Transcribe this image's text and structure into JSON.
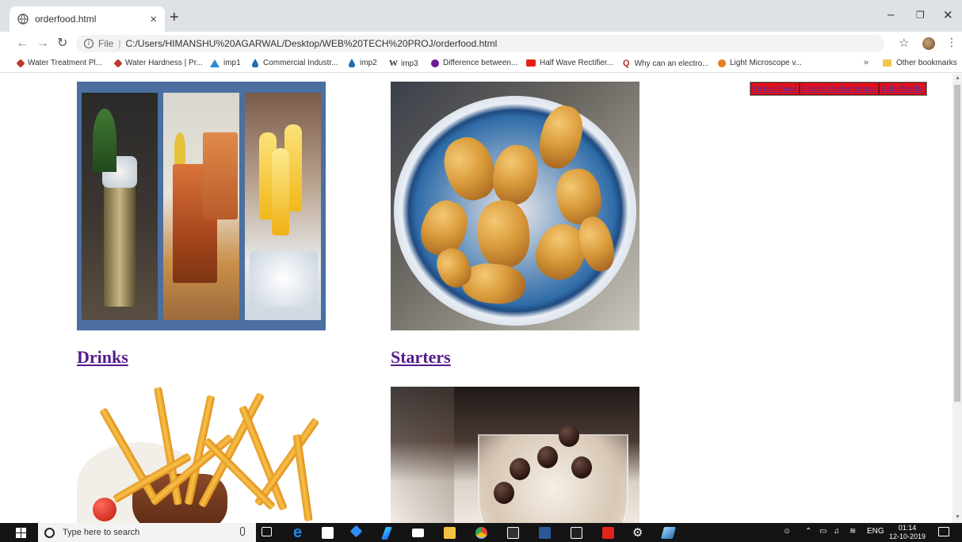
{
  "browser": {
    "tab_title": "orderfood.html",
    "tab_close": "×",
    "new_tab": "+",
    "address": {
      "scheme": "File",
      "separator": "|",
      "url": "C:/Users/HIMANSHU%20AGARWAL/Desktop/WEB%20TECH%20PROJ/orderfood.html"
    },
    "bookmarks": [
      {
        "label": "Water Treatment Pl...",
        "icon": "water-treatment-icon",
        "color": "#c0392b"
      },
      {
        "label": "Water Hardness | Pr...",
        "icon": "water-hardness-icon",
        "color": "#c0392b"
      },
      {
        "label": "imp1",
        "icon": "triangle-icon",
        "color": "#2a8ad4"
      },
      {
        "label": "Commercial Industr...",
        "icon": "droplet-icon",
        "color": "#1d6fb8"
      },
      {
        "label": "imp2",
        "icon": "droplet-icon",
        "color": "#1d6fb8"
      },
      {
        "label": "imp3",
        "icon": "wikipedia-icon",
        "color": "#222222"
      },
      {
        "label": "Difference between...",
        "icon": "circle-e-icon",
        "color": "#6a1b9a"
      },
      {
        "label": "Half Wave Rectifier...",
        "icon": "youtube-icon",
        "color": "#e62117"
      },
      {
        "label": "Why can an electro...",
        "icon": "quora-icon",
        "color": "#b92b27"
      },
      {
        "label": "Light Microscope v...",
        "icon": "circle-d-icon",
        "color": "#e67e22"
      }
    ],
    "bookmarks_more": "»",
    "other_bookmarks": "Other bookmarks"
  },
  "nav": {
    "order_food": "Order Food",
    "check_order_status": "Check Order Status",
    "edit_profile": "Edit Profile"
  },
  "menu": {
    "items": [
      {
        "label": "Drinks"
      },
      {
        "label": "Starters"
      }
    ]
  },
  "taskbar": {
    "search_placeholder": "Type here to search",
    "language": "ENG",
    "time": "01:14",
    "date": "12-10-2019"
  }
}
